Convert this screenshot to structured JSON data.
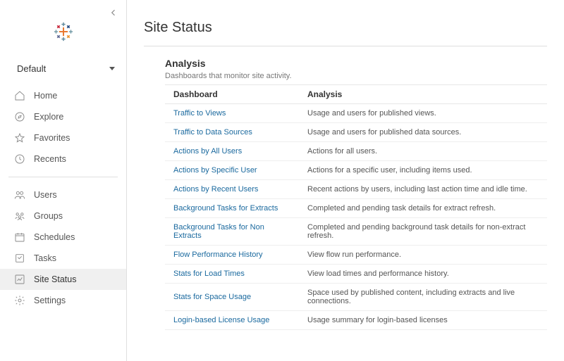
{
  "site": {
    "name": "Default"
  },
  "nav": {
    "home": "Home",
    "explore": "Explore",
    "favorites": "Favorites",
    "recents": "Recents",
    "users": "Users",
    "groups": "Groups",
    "schedules": "Schedules",
    "tasks": "Tasks",
    "site_status": "Site Status",
    "settings": "Settings"
  },
  "page": {
    "title": "Site Status"
  },
  "section": {
    "title": "Analysis",
    "subtitle": "Dashboards that monitor site activity."
  },
  "columns": {
    "dashboard": "Dashboard",
    "analysis": "Analysis"
  },
  "rows": [
    {
      "name": "Traffic to Views",
      "desc": "Usage and users for published views."
    },
    {
      "name": "Traffic to Data Sources",
      "desc": "Usage and users for published data sources."
    },
    {
      "name": "Actions by All Users",
      "desc": "Actions for all users."
    },
    {
      "name": "Actions by Specific User",
      "desc": "Actions for a specific user, including items used."
    },
    {
      "name": "Actions by Recent Users",
      "desc": "Recent actions by users, including last action time and idle time."
    },
    {
      "name": "Background Tasks for Extracts",
      "desc": "Completed and pending task details for extract refresh."
    },
    {
      "name": "Background Tasks for Non Extracts",
      "desc": "Completed and pending background task details for non-extract refresh."
    },
    {
      "name": "Flow Performance History",
      "desc": "View flow run performance."
    },
    {
      "name": "Stats for Load Times",
      "desc": "View load times and performance history."
    },
    {
      "name": "Stats for Space Usage",
      "desc": "Space used by published content, including extracts and live connections."
    },
    {
      "name": "Login-based License Usage",
      "desc": "Usage summary for login-based licenses"
    }
  ]
}
